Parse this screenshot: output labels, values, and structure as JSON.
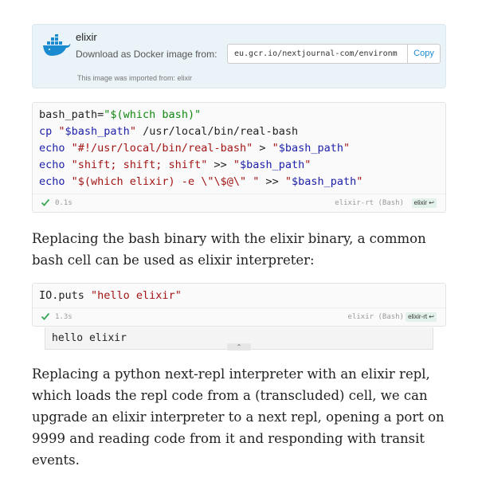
{
  "docker": {
    "name": "elixir",
    "download_label": "Download as Docker image from:",
    "url": "eu.gcr.io/nextjournal-com/environm",
    "copy_label": "Copy",
    "imported_note": "This image was imported from: elixir",
    "icon": "docker-whale-icon",
    "accent": "#1a8bd0"
  },
  "cell1": {
    "lines": [
      [
        {
          "t": "bash_path=",
          "c": "plain"
        },
        {
          "t": "\"$(which bash)\"",
          "c": "grn"
        }
      ],
      [
        {
          "t": "cp ",
          "c": "kw"
        },
        {
          "t": "\"",
          "c": "str"
        },
        {
          "t": "$bash_path",
          "c": "var"
        },
        {
          "t": "\"",
          "c": "str"
        },
        {
          "t": " /usr/local/bin/real-bash",
          "c": "plain"
        }
      ],
      [
        {
          "t": "echo ",
          "c": "kw"
        },
        {
          "t": "\"#!/usr/local/bin/real-bash\"",
          "c": "str"
        },
        {
          "t": " > ",
          "c": "plain"
        },
        {
          "t": "\"",
          "c": "str"
        },
        {
          "t": "$bash_path",
          "c": "var"
        },
        {
          "t": "\"",
          "c": "str"
        }
      ],
      [
        {
          "t": "echo ",
          "c": "kw"
        },
        {
          "t": "\"shift; shift; shift\"",
          "c": "str"
        },
        {
          "t": " >> ",
          "c": "plain"
        },
        {
          "t": "\"",
          "c": "str"
        },
        {
          "t": "$bash_path",
          "c": "var"
        },
        {
          "t": "\"",
          "c": "str"
        }
      ],
      [
        {
          "t": "echo ",
          "c": "kw"
        },
        {
          "t": "\"$(which elixir) -e \\\"\\$@\\\" \"",
          "c": "str"
        },
        {
          "t": " >> ",
          "c": "plain"
        },
        {
          "t": "\"",
          "c": "str"
        },
        {
          "t": "$bash_path",
          "c": "var"
        },
        {
          "t": "\"",
          "c": "str"
        }
      ]
    ],
    "duration": "0.1s",
    "environment": "elixir-rt (Bash)",
    "runner": "elixir ↩"
  },
  "para1": "Replacing the bash binary with the elixir binary, a common bash cell can be used as elixir interpreter:",
  "cell2": {
    "lines": [
      [
        {
          "t": "IO.puts ",
          "c": "plain"
        },
        {
          "t": "\"hello elixir\"",
          "c": "str"
        }
      ]
    ],
    "duration": "1.3s",
    "environment": "elixir (Bash)",
    "runner": "elixir-rt ↩",
    "output": "hello elixir",
    "collapse_icon": "chevron-up-icon"
  },
  "para2": "Replacing a python next-repl interpreter with an elixir repl, which loads the repl code from a (transcluded) cell, we can upgrade an elixir interpreter to a next repl, opening a port on 9999 and reading code from it and responding with transit events.",
  "colors": {
    "keyword": "#1c1fa8",
    "string": "#a31515",
    "green_string": "#118811",
    "check": "#3aa757"
  }
}
